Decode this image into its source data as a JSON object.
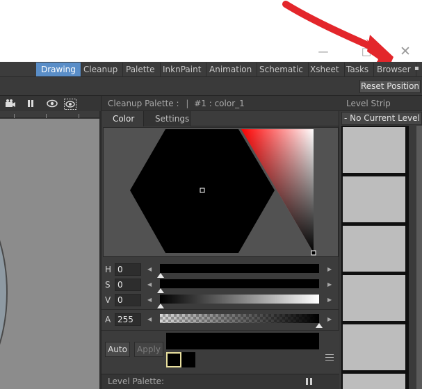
{
  "window": {
    "minimize_glyph": "—",
    "maximize_glyph": "□",
    "close_glyph": "✕"
  },
  "rooms": {
    "tabs": [
      "Drawing",
      "Cleanup",
      "Palette",
      "InknPaint",
      "Animation",
      "Schematic",
      "Xsheet",
      "Tasks",
      "Browser"
    ],
    "active": "Drawing"
  },
  "toolbar": {
    "reset_label": "Reset Position"
  },
  "viewer": {
    "icons": [
      "camera-icon",
      "pause-icon",
      "eye-icon",
      "preview-eye-icon"
    ]
  },
  "cleanup_palette": {
    "title": "Cleanup Palette :",
    "separator": "|",
    "style_name": "#1 : color_1",
    "tabs": [
      "Color",
      "Settings"
    ],
    "active_tab": "Color",
    "hue": "0",
    "saturation": "0",
    "value": "0",
    "alpha": "255",
    "labels": {
      "h": "H",
      "s": "S",
      "v": "V",
      "a": "A"
    },
    "auto_label": "Auto",
    "apply_label": "Apply",
    "current_color": "#000000",
    "previous_color": "#000000"
  },
  "level_palette": {
    "title": "Level Palette:"
  },
  "level_strip": {
    "title": "Level Strip",
    "combo_value": "- No Current Level -",
    "frames_visible": 6
  },
  "colors": {
    "active_room": "#5a8ec8",
    "annotation_arrow": "#e3262b",
    "swatch_border": "#e8df9e"
  }
}
